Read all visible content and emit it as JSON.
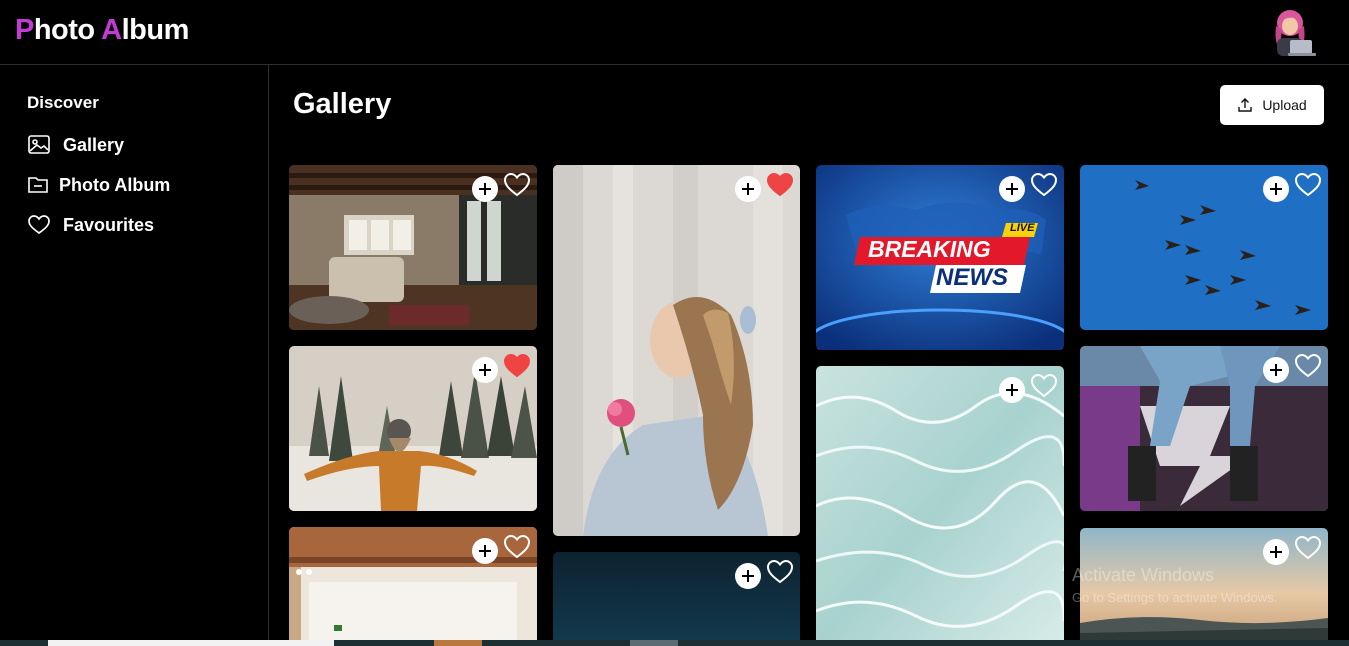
{
  "header": {
    "brand_initial_1": "P",
    "brand_rest_1": "hoto ",
    "brand_initial_2": "A",
    "brand_rest_2": "lbum",
    "avatar_alt": "user avatar"
  },
  "sidebar": {
    "heading": "Discover",
    "items": [
      {
        "label": "Gallery",
        "icon": "image-icon"
      },
      {
        "label": "Photo Album",
        "icon": "folder-icon"
      },
      {
        "label": "Favourites",
        "icon": "heart-icon"
      }
    ]
  },
  "main": {
    "title": "Gallery",
    "upload_label": "Upload"
  },
  "photos": [
    {
      "subject": "living room interior",
      "favourite": false
    },
    {
      "subject": "woman in snowy forest",
      "favourite": true
    },
    {
      "subject": "bright room with beams",
      "favourite": false
    },
    {
      "subject": "woman holding flower",
      "favourite": true
    },
    {
      "subject": "dark blue gradient",
      "favourite": false
    },
    {
      "subject": "breaking news banner",
      "favourite": false,
      "banner_top": "BREAKING",
      "banner_bottom": "NEWS",
      "banner_tag": "LIVE"
    },
    {
      "subject": "clear pool water",
      "favourite": false
    },
    {
      "subject": "geese flying in blue sky",
      "favourite": false
    },
    {
      "subject": "legs on graffiti wall",
      "favourite": false
    },
    {
      "subject": "city at sunset",
      "favourite": false
    }
  ],
  "colors": {
    "brand_accent": "#c23bd4",
    "favourite_red": "#ef4444",
    "background": "#000000"
  },
  "watermark": {
    "line1": "Activate Windows",
    "line2": "Go to Settings to activate Windows."
  }
}
